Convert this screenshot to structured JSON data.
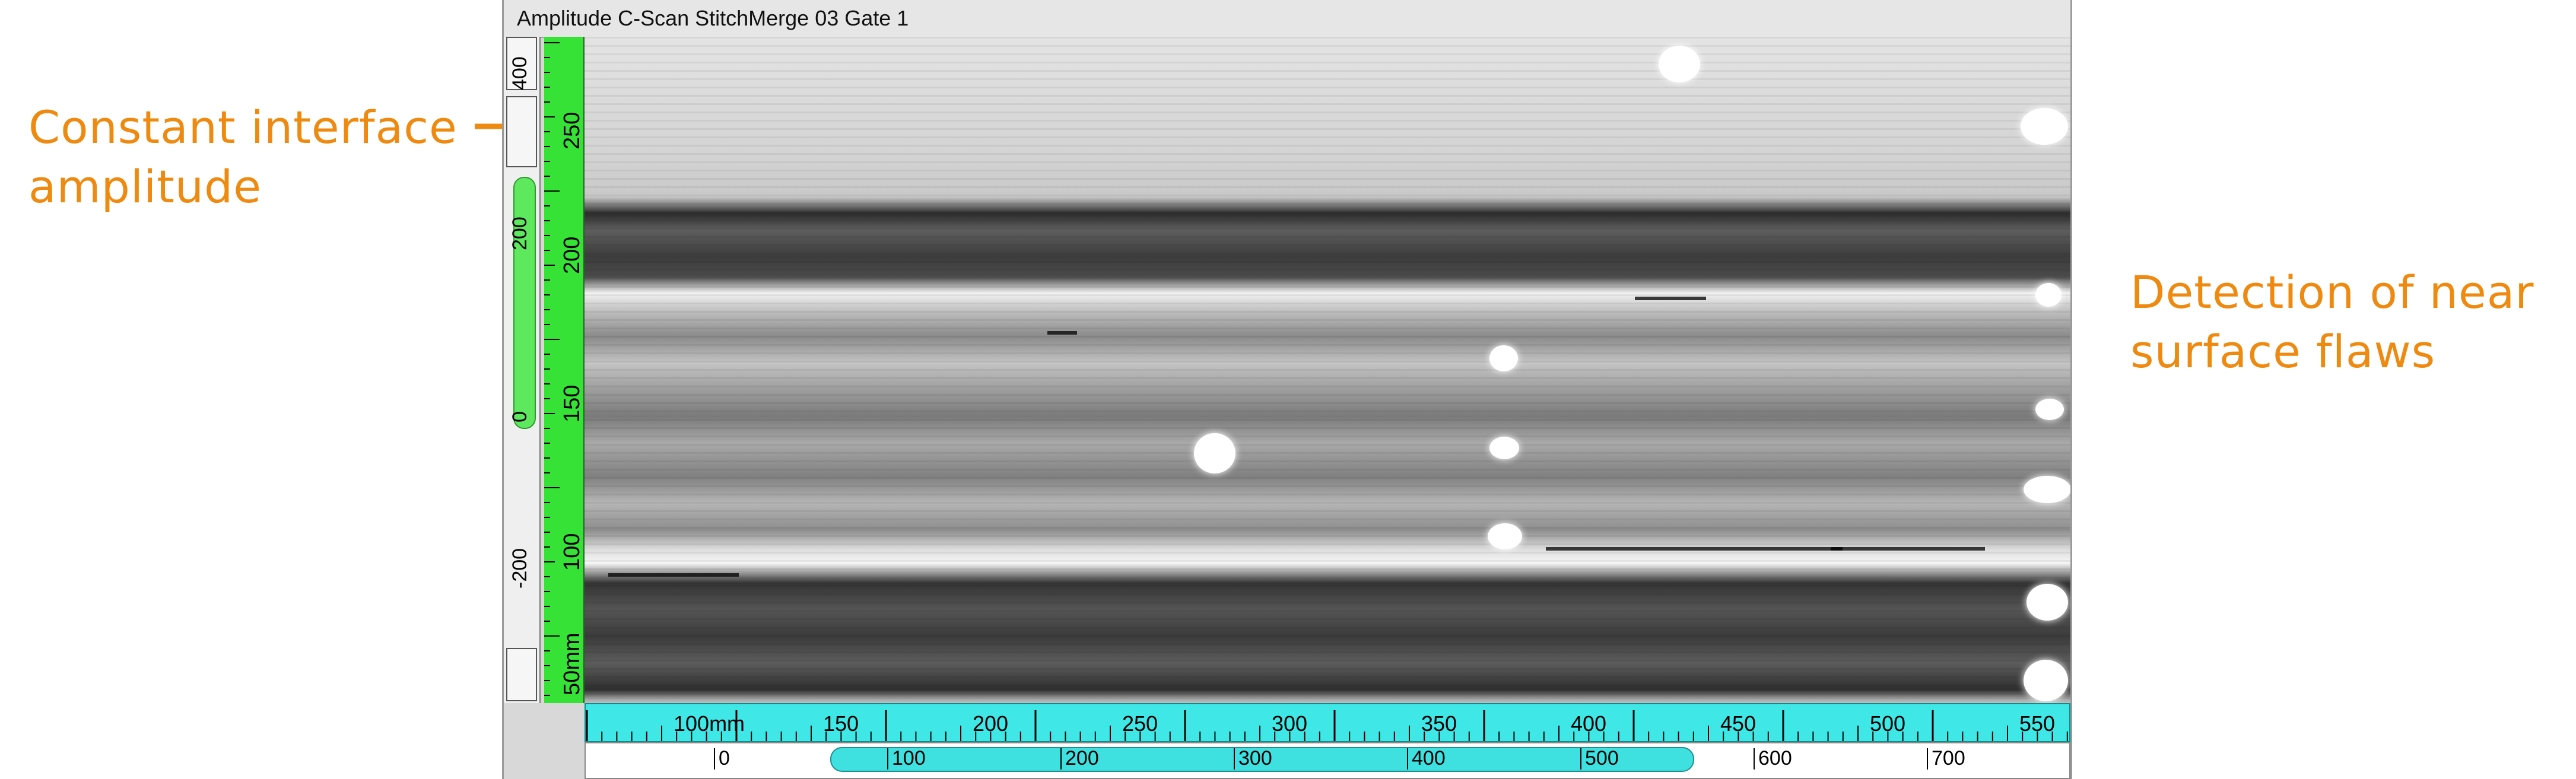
{
  "annotations": {
    "left": "Constant interface\namplitude",
    "right": "Detection of near\nsurface flaws",
    "color": "#ef8a10"
  },
  "window": {
    "title": "Amplitude C-Scan StitchMerge 03 Gate 1"
  },
  "gray_ruler": {
    "labels": [
      "400",
      "200",
      "0",
      "-200"
    ],
    "thumb_color": "#5ee85e"
  },
  "vertical_ruler": {
    "labels": [
      "250",
      "200",
      "150",
      "100",
      "50mm"
    ],
    "color": "#37e237"
  },
  "horizontal_ruler": {
    "labels": [
      "100mm",
      "150",
      "200",
      "250",
      "300",
      "350",
      "400",
      "450",
      "500",
      "550"
    ],
    "color": "#3fe7e7"
  },
  "horizontal_scroll": {
    "labels": [
      "0",
      "100",
      "200",
      "300",
      "400",
      "500",
      "600",
      "700"
    ],
    "thumb_color": "#3fe0e0"
  },
  "icons": {
    "annotation_arrow": "arrow-right-icon"
  }
}
